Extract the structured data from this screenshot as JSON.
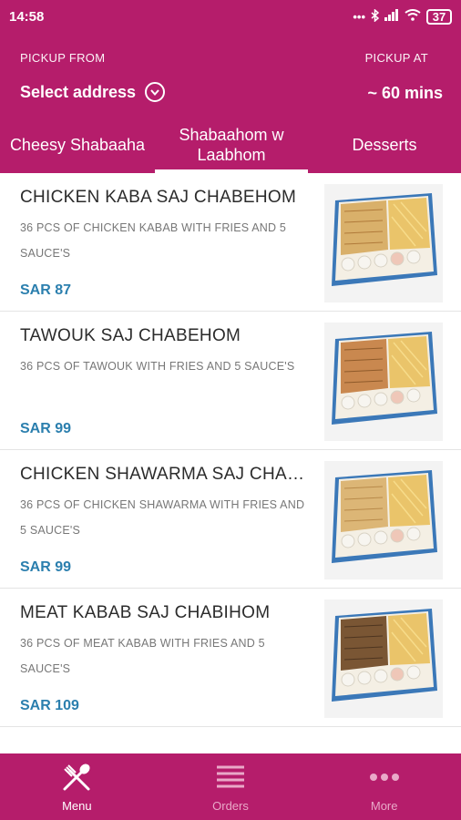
{
  "status_bar": {
    "time": "14:58",
    "battery": "37"
  },
  "header": {
    "pickup_from_label": "PICKUP FROM",
    "pickup_at_label": "PICKUP AT",
    "address": "Select address",
    "eta": "~ 60 mins"
  },
  "tabs": [
    {
      "label": "Cheesy Shabaaha",
      "active": false
    },
    {
      "label": "Shabaahom w Laabhom",
      "active": true
    },
    {
      "label": "Desserts",
      "active": false
    }
  ],
  "items": [
    {
      "name": "CHICKEN KABA SAJ CHABEHOM",
      "desc": "36 PCS OF CHICKEN KABAB WITH FRIES AND 5 SAUCE'S",
      "price": "SAR 87"
    },
    {
      "name": "TAWOUK SAJ CHABEHOM",
      "desc": "36 PCS OF TAWOUK WITH FRIES AND 5 SAUCE'S",
      "price": "SAR 99"
    },
    {
      "name": "CHICKEN SHAWARMA SAJ CHAB...",
      "desc": "36 PCS OF CHICKEN SHAWARMA WITH FRIES AND 5 SAUCE'S",
      "price": "SAR 99"
    },
    {
      "name": "MEAT KABAB SAJ CHABIHOM",
      "desc": "36 PCS OF MEAT KABAB WITH FRIES AND 5 SAUCE'S",
      "price": "SAR 109"
    }
  ],
  "bottom_nav": [
    {
      "label": "Menu",
      "icon": "fork-spoon-icon",
      "active": true
    },
    {
      "label": "Orders",
      "icon": "list-icon",
      "active": false
    },
    {
      "label": "More",
      "icon": "more-dots-icon",
      "active": false
    }
  ],
  "colors": {
    "brand": "#b51d6b",
    "price": "#2b7fae"
  }
}
